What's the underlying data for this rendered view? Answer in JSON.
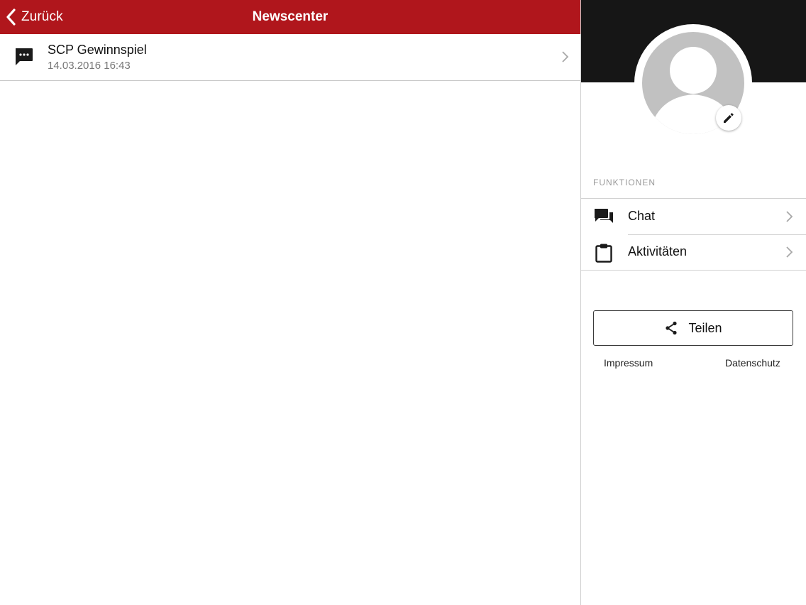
{
  "navbar": {
    "back_label": "Zurück",
    "title": "Newscenter",
    "icons": {
      "back": "chevron-left-icon"
    }
  },
  "news": {
    "items": [
      {
        "title": "SCP Gewinnspiel",
        "date": "14.03.2016 16:43",
        "icon": "message-icon"
      }
    ]
  },
  "profile": {
    "avatar_icon": "user-placeholder-icon",
    "edit_icon": "pencil-icon"
  },
  "functions": {
    "header": "FUNKTIONEN",
    "items": [
      {
        "label": "Chat",
        "icon": "chat-bubbles-icon"
      },
      {
        "label": "Aktivitäten",
        "icon": "clipboard-icon"
      }
    ]
  },
  "share": {
    "label": "Teilen",
    "icon": "share-icon"
  },
  "footer": {
    "impressum": "Impressum",
    "datenschutz": "Datenschutz"
  },
  "colors": {
    "navbar_bg": "#b0161c",
    "profile_header_bg": "#161616",
    "avatar_bg": "#c1c1c1",
    "divider": "#cfcfcf"
  }
}
